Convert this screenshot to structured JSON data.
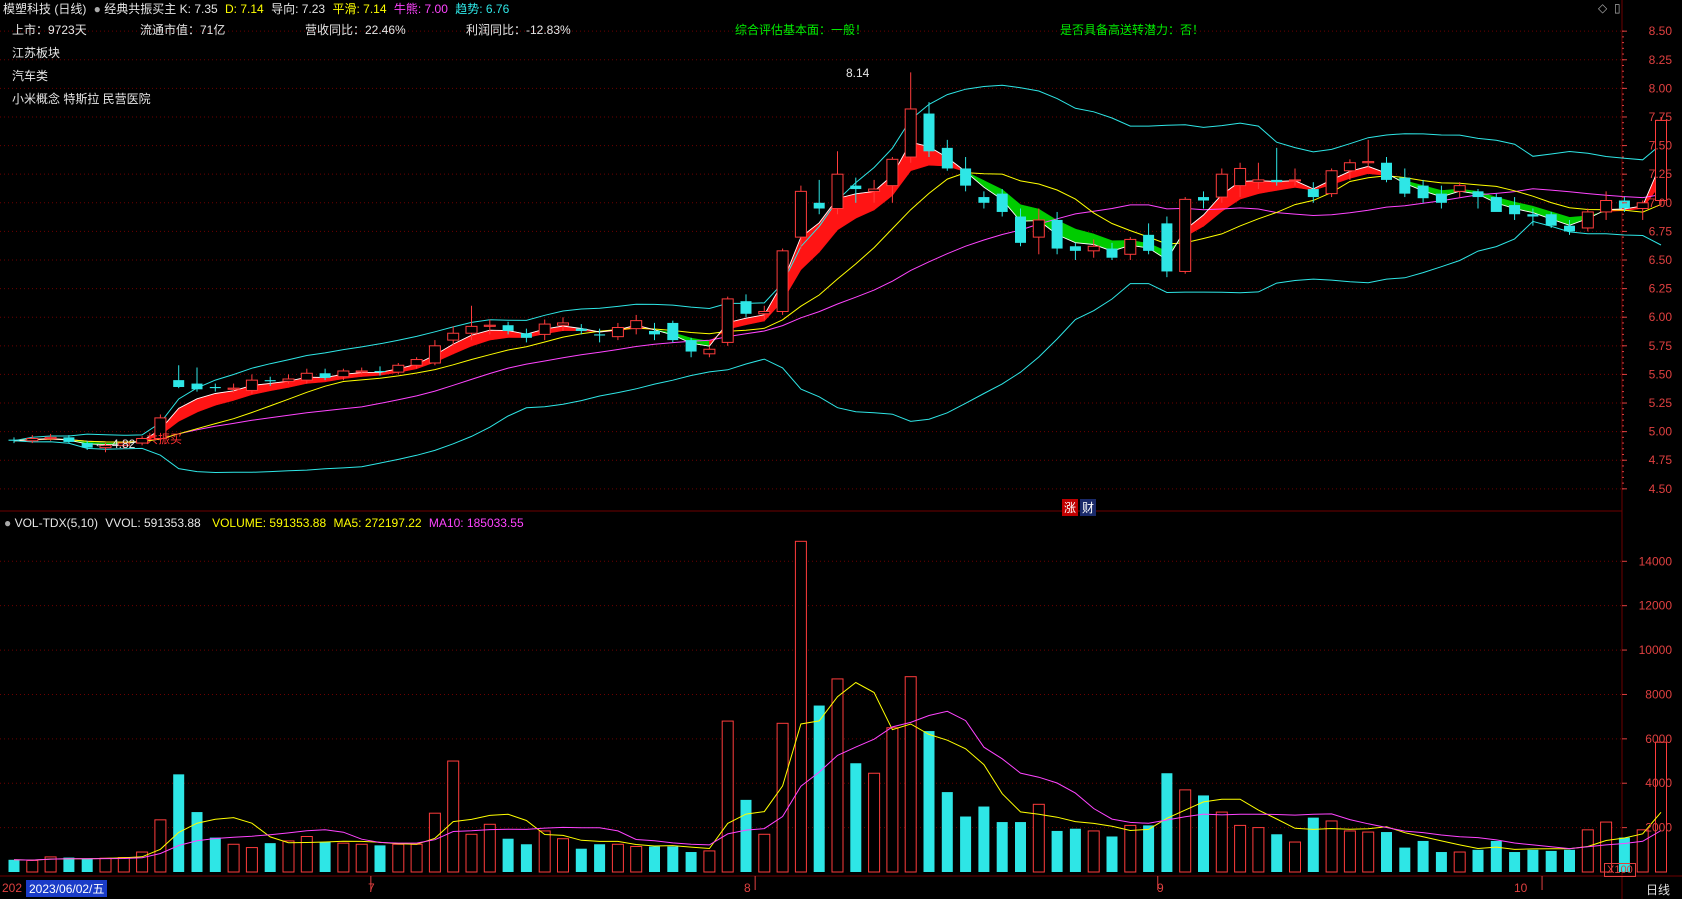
{
  "indicator_line": {
    "stock_name": "模塑科技 (日线)",
    "indicator_name": "经典共振买主",
    "k_label": "K:",
    "k_value": "7.35",
    "d_label": "D:",
    "d_value": "7.14",
    "guide_label": "导向:",
    "guide_value": "7.23",
    "smooth_label": "平滑:",
    "smooth_value": "7.14",
    "bullbear_label": "牛熊:",
    "bullbear_value": "7.00",
    "trend_label": "趋势:",
    "trend_value": "6.76"
  },
  "info": {
    "listed": "上市：9723天",
    "float_cap": "流通市值：71亿",
    "revenue_yoy": "营收同比：22.46%",
    "profit_yoy": "利润同比：-12.83%",
    "assessment": "综合评估基本面：一般！",
    "potential": "是否具备高送转潜力：否！",
    "sector": "江苏板块",
    "industry": "汽车类",
    "concepts": "小米概念 特斯拉 民营医院"
  },
  "annotations": {
    "high_label": "8.14",
    "low_label": "4.82",
    "buy_signal": "共振买",
    "event_rise": "涨",
    "event_fin": "财"
  },
  "volume_header": {
    "name": "VOL-TDX(5,10)",
    "vvol": "VVOL: 591353.88",
    "volume": "VOLUME: 591353.88",
    "ma5": "MA5: 272197.22",
    "ma10": "MA10: 185033.55"
  },
  "x_axis": {
    "start_date": "2023/06/02/五",
    "start_prefix": "202",
    "months": [
      "7",
      "8",
      "9",
      "10"
    ],
    "period": "日线",
    "vol_unit": "X100"
  },
  "colors": {
    "up": "#ff3c3c",
    "down": "#2ee6e6",
    "ma5": "#ffff00",
    "ma10": "#ff44ff",
    "grid": "#6e0000",
    "axis_text": "#e04040",
    "ribbon_up": "#ff1414",
    "ribbon_down": "#00cc00"
  },
  "chart_data": [
    {
      "type": "candlestick",
      "title": "",
      "y_ticks": [
        "8.50",
        "8.25",
        "8.00",
        "7.75",
        "7.50",
        "7.25",
        "7.00",
        "6.75",
        "6.50",
        "6.25",
        "6.00",
        "5.75",
        "5.50",
        "5.25",
        "5.00",
        "4.75",
        "4.50"
      ],
      "ylim": [
        4.35,
        8.65
      ],
      "candles": [
        [
          4.93,
          4.95,
          4.9,
          4.92
        ],
        [
          4.92,
          4.97,
          4.9,
          4.94
        ],
        [
          4.94,
          4.98,
          4.92,
          4.95
        ],
        [
          4.95,
          4.97,
          4.9,
          4.91
        ],
        [
          4.9,
          4.92,
          4.84,
          4.86
        ],
        [
          4.86,
          4.9,
          4.82,
          4.88
        ],
        [
          4.88,
          4.93,
          4.85,
          4.9
        ],
        [
          4.9,
          4.96,
          4.88,
          4.94
        ],
        [
          4.94,
          5.15,
          4.92,
          5.12
        ],
        [
          5.45,
          5.58,
          5.38,
          5.39
        ],
        [
          5.42,
          5.56,
          5.35,
          5.37
        ],
        [
          5.39,
          5.42,
          5.35,
          5.38
        ],
        [
          5.37,
          5.42,
          5.34,
          5.38
        ],
        [
          5.36,
          5.5,
          5.33,
          5.45
        ],
        [
          5.45,
          5.48,
          5.4,
          5.44
        ],
        [
          5.44,
          5.5,
          5.42,
          5.46
        ],
        [
          5.45,
          5.55,
          5.42,
          5.51
        ],
        [
          5.51,
          5.55,
          5.45,
          5.47
        ],
        [
          5.48,
          5.55,
          5.45,
          5.53
        ],
        [
          5.52,
          5.56,
          5.5,
          5.53
        ],
        [
          5.53,
          5.57,
          5.49,
          5.52
        ],
        [
          5.52,
          5.6,
          5.5,
          5.58
        ],
        [
          5.58,
          5.65,
          5.55,
          5.63
        ],
        [
          5.6,
          5.8,
          5.58,
          5.75
        ],
        [
          5.8,
          5.92,
          5.75,
          5.86
        ],
        [
          5.86,
          6.1,
          5.8,
          5.92
        ],
        [
          5.92,
          5.98,
          5.85,
          5.93
        ],
        [
          5.93,
          5.96,
          5.85,
          5.88
        ],
        [
          5.86,
          5.9,
          5.78,
          5.82
        ],
        [
          5.85,
          5.98,
          5.8,
          5.94
        ],
        [
          5.93,
          6.0,
          5.88,
          5.95
        ],
        [
          5.9,
          5.94,
          5.85,
          5.88
        ],
        [
          5.85,
          5.9,
          5.78,
          5.84
        ],
        [
          5.83,
          5.95,
          5.8,
          5.91
        ],
        [
          5.9,
          6.02,
          5.85,
          5.97
        ],
        [
          5.88,
          5.95,
          5.8,
          5.85
        ],
        [
          5.95,
          5.97,
          5.78,
          5.8
        ],
        [
          5.8,
          5.82,
          5.65,
          5.7
        ],
        [
          5.68,
          5.74,
          5.65,
          5.72
        ],
        [
          5.78,
          6.18,
          5.75,
          6.16
        ],
        [
          6.14,
          6.2,
          6.0,
          6.03
        ],
        [
          6.03,
          6.1,
          5.98,
          6.05
        ],
        [
          6.05,
          6.6,
          6.02,
          6.58
        ],
        [
          6.7,
          7.15,
          6.6,
          7.1
        ],
        [
          7.0,
          7.2,
          6.9,
          6.95
        ],
        [
          6.95,
          7.45,
          6.9,
          7.25
        ],
        [
          7.15,
          7.22,
          7.0,
          7.12
        ],
        [
          7.1,
          7.2,
          7.0,
          7.12
        ],
        [
          7.15,
          7.4,
          7.0,
          7.38
        ],
        [
          7.4,
          8.14,
          7.35,
          7.82
        ],
        [
          7.78,
          7.88,
          7.4,
          7.45
        ],
        [
          7.48,
          7.55,
          7.28,
          7.3
        ],
        [
          7.3,
          7.4,
          7.1,
          7.15
        ],
        [
          7.05,
          7.1,
          6.95,
          7.0
        ],
        [
          7.08,
          7.12,
          6.88,
          6.92
        ],
        [
          6.88,
          6.95,
          6.62,
          6.65
        ],
        [
          6.7,
          6.95,
          6.55,
          6.85
        ],
        [
          6.85,
          6.92,
          6.55,
          6.6
        ],
        [
          6.62,
          6.65,
          6.5,
          6.58
        ],
        [
          6.58,
          6.68,
          6.52,
          6.62
        ],
        [
          6.6,
          6.65,
          6.5,
          6.52
        ],
        [
          6.55,
          6.7,
          6.5,
          6.68
        ],
        [
          6.72,
          6.82,
          6.55,
          6.58
        ],
        [
          6.82,
          6.88,
          6.35,
          6.4
        ],
        [
          6.4,
          7.05,
          6.38,
          7.03
        ],
        [
          7.05,
          7.1,
          6.95,
          7.02
        ],
        [
          7.05,
          7.3,
          7.0,
          7.25
        ],
        [
          7.15,
          7.35,
          7.05,
          7.3
        ],
        [
          7.18,
          7.35,
          7.12,
          7.2
        ],
        [
          7.2,
          7.48,
          7.15,
          7.18
        ],
        [
          7.2,
          7.3,
          7.15,
          7.2
        ],
        [
          7.12,
          7.18,
          7.0,
          7.05
        ],
        [
          7.08,
          7.3,
          7.05,
          7.28
        ],
        [
          7.28,
          7.38,
          7.2,
          7.35
        ],
        [
          7.35,
          7.55,
          7.3,
          7.36
        ],
        [
          7.35,
          7.4,
          7.18,
          7.2
        ],
        [
          7.22,
          7.3,
          7.05,
          7.08
        ],
        [
          7.15,
          7.2,
          7.0,
          7.04
        ],
        [
          7.08,
          7.15,
          6.95,
          7.0
        ],
        [
          7.1,
          7.18,
          7.05,
          7.15
        ],
        [
          7.1,
          7.12,
          6.95,
          7.05
        ],
        [
          7.05,
          7.08,
          6.95,
          6.92
        ],
        [
          6.98,
          7.05,
          6.85,
          6.9
        ],
        [
          6.9,
          6.95,
          6.8,
          6.88
        ],
        [
          6.9,
          6.92,
          6.78,
          6.8
        ],
        [
          6.8,
          6.85,
          6.72,
          6.75
        ],
        [
          6.78,
          6.95,
          6.75,
          6.92
        ],
        [
          6.92,
          7.1,
          6.85,
          7.02
        ],
        [
          7.02,
          7.05,
          6.92,
          6.95
        ],
        [
          6.95,
          7.02,
          6.85,
          7.0
        ],
        [
          7.02,
          7.75,
          6.98,
          7.72
        ]
      ]
    },
    {
      "type": "bar",
      "title": "VOL-TDX(5,10)",
      "y_ticks": [
        "14000",
        "12000",
        "10000",
        "8000",
        "6000",
        "4000",
        "2000"
      ],
      "ylim": [
        0,
        15500
      ],
      "values": [
        550,
        520,
        680,
        650,
        600,
        620,
        650,
        900,
        2350,
        4400,
        2700,
        1550,
        1250,
        1100,
        1300,
        1400,
        1600,
        1350,
        1300,
        1250,
        1200,
        1250,
        1250,
        2650,
        5000,
        1700,
        2150,
        1500,
        1250,
        1850,
        1500,
        1050,
        1250,
        1250,
        1150,
        1150,
        1150,
        900,
        950,
        6800,
        3250,
        1700,
        6700,
        14900,
        7500,
        8700,
        4900,
        4450,
        6500,
        8800,
        6350,
        3600,
        2500,
        2950,
        2250,
        2250,
        3050,
        1850,
        1950,
        1850,
        1600,
        2100,
        2100,
        4450,
        3700,
        3450,
        2700,
        2100,
        2000,
        1700,
        1350,
        2450,
        2300,
        1850,
        1800,
        1800,
        1100,
        1400,
        900,
        900,
        1000,
        1400,
        900,
        1000,
        950,
        1000,
        1900,
        2250,
        1550,
        1900,
        5850
      ]
    }
  ]
}
